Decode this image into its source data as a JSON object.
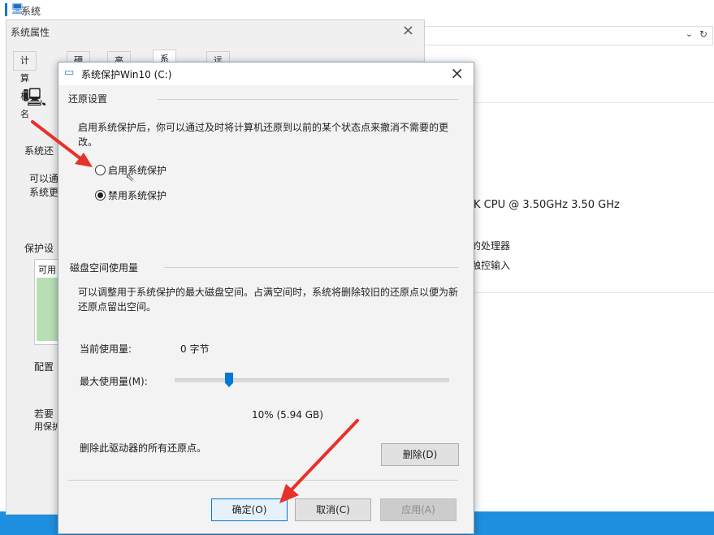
{
  "background": {
    "window_title": "系统",
    "cpu_text": "K CPU @ 3.50GHz   3.50 GHz",
    "processor_text": "的处理器",
    "touch_text": "触控输入"
  },
  "system_properties": {
    "title": "系统属性",
    "tabs": [
      "计算机名",
      "硬件",
      "高级",
      "系统保护",
      "远程"
    ],
    "side_texts": [
      "系统还",
      "可以通",
      "系统更",
      "保护设",
      "配置",
      "若要",
      "用保护"
    ],
    "list_header": "可用"
  },
  "dialog": {
    "title": "系统保护Win10 (C:)",
    "restore_group": "还原设置",
    "restore_desc": "启用系统保护后，你可以通过及时将计算机还原到以前的某个状态点来撤消不需要的更改。",
    "radio_enable": "启用系统保护",
    "radio_disable": "禁用系统保护",
    "radio_selected": "disable",
    "disk_group": "磁盘空间使用量",
    "disk_desc": "可以调整用于系统保护的最大磁盘空间。占满空间时，系统将删除较旧的还原点以便为新还原点留出空间。",
    "current_usage_label": "当前使用量:",
    "current_usage_value": "0 字节",
    "max_usage_label": "最大使用量(M):",
    "max_usage_percent": 10,
    "max_usage_value": "10% (5.94 GB)",
    "delete_label": "删除此驱动器的所有还原点。",
    "delete_button": "删除(D)",
    "ok_button": "确定(O)",
    "cancel_button": "取消(C)",
    "apply_button": "应用(A)"
  },
  "colors": {
    "accent": "#0078d7",
    "annotation_arrow": "#e8302a",
    "taskbar": "#1f8fe0"
  }
}
